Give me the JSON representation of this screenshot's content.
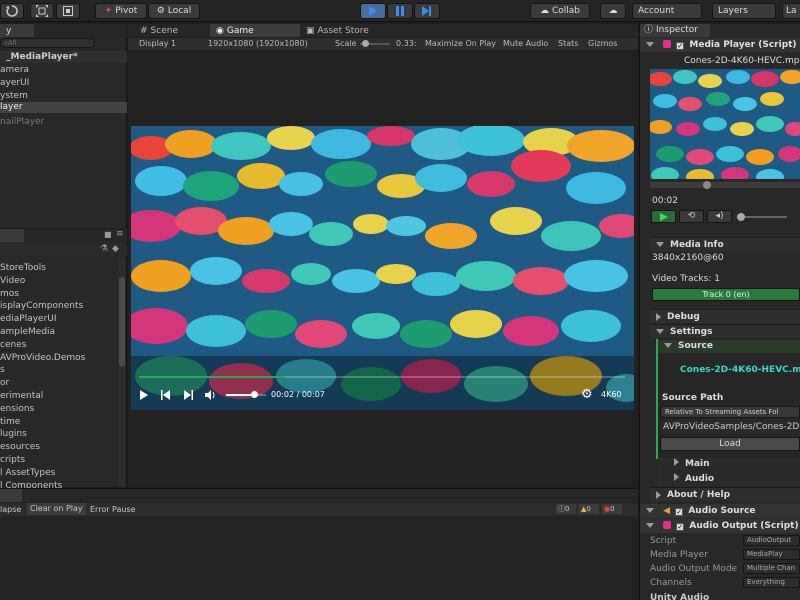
{
  "toolbar": {
    "pivot": "Pivot",
    "local": "Local",
    "collab": "Collab",
    "account": "Account",
    "layers": "Layers",
    "layout": "La"
  },
  "hierarchy": {
    "tab": "y",
    "search_placeholder": "All",
    "scene": "_MediaPlayer*",
    "items": [
      "amera",
      "ayerUI",
      "ystem",
      "layer",
      "nailPlayer"
    ]
  },
  "project": {
    "items": [
      "StoreTools",
      "Video",
      "mos",
      "isplayComponents",
      "ediaPlayerUI",
      "ampleMedia",
      "cenes",
      "AVProVideo.Demos",
      "s",
      "or",
      "erimental",
      "ensions",
      "time",
      "lugins",
      "esources",
      "cripts",
      "l AssetTypes",
      "l Components"
    ]
  },
  "center_tabs": {
    "scene": "Scene",
    "game": "Game",
    "asset_store": "Asset Store"
  },
  "game_bar": {
    "display": "Display 1",
    "resolution": "1920x1080 (1920x1080)",
    "scale_label": "Scale",
    "scale_value": "0.33:",
    "maximize": "Maximize On Play",
    "mute": "Mute Audio",
    "stats": "Stats",
    "gizmos": "Gizmos"
  },
  "video_player": {
    "time": "00:02 / 00:07",
    "quality": "4K60",
    "progress": 0.3,
    "volume": 0.7
  },
  "console": {
    "collapse": "lapse",
    "clear_on_play": "Clear on Play",
    "error_pause": "Error Pause",
    "count_errors": "0",
    "count_warnings": "0",
    "count_logs": "0"
  },
  "inspector": {
    "tab": "Inspector",
    "media_player_component": "Media Player (Script)",
    "video_file": "Cones-2D-4K60-HEVC.mp",
    "current_time": "00:02",
    "media_info": "Media Info",
    "resolution": "3840x2160@60",
    "video_tracks": "Video Tracks: 1",
    "track": "Track 0 (en)",
    "debug": "Debug",
    "settings": "Settings",
    "source": "Source",
    "source_file": "Cones-2D-4K60-HEVC.m",
    "source_path_label": "Source Path",
    "source_path_mode": "Relative To Streaming Assets Fol",
    "source_path": "AVProVideoSamples/Cones-2D",
    "load": "Load",
    "main": "Main",
    "audio": "Audio",
    "about": "About / Help",
    "audio_source": "Audio Source",
    "audio_output": "Audio Output (Script)",
    "script_label": "Script",
    "script_value": "AudioOutput",
    "media_player_label": "Media Player",
    "media_player_value": "MediaPlay",
    "output_mode_label": "Audio Output Mode",
    "output_mode_value": "Multiple Chan",
    "channels_label": "Channels",
    "channels_value": "Everything",
    "unity_audio": "Unity Audio"
  },
  "colors": {
    "accent_green": "#2aa853",
    "teal": "#30b8a0",
    "play_blue": "#3f7fd0"
  }
}
